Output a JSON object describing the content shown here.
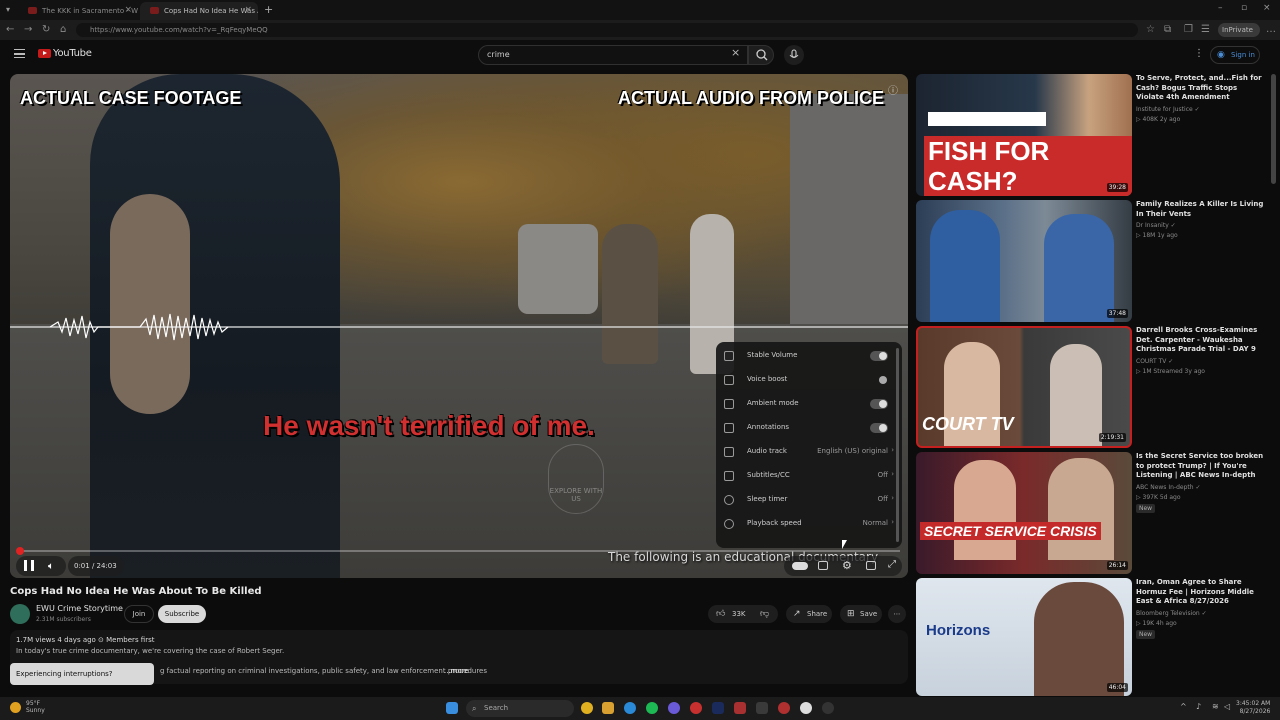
{
  "browser": {
    "tabs": [
      {
        "label": "The KKK in Sacramento - What W..."
      },
      {
        "label": "Cops Had No Idea He Was Ab..."
      }
    ],
    "url": "https://www.youtube.com/watch?v=_RqFeqyMeQQ",
    "profile_label": "InPrivate"
  },
  "masthead": {
    "logo_text": "YouTube",
    "search_value": "crime",
    "signin_label": "Sign in"
  },
  "video": {
    "overlay_left": "ACTUAL CASE FOOTAGE",
    "overlay_right": "ACTUAL AUDIO FROM POLICE",
    "caption": "He wasn't terrified of me.",
    "subtitle": "The following is an educational documentary",
    "watermark": "EXPLORE WITH US",
    "time": "0:01 / 24:03",
    "progress_fraction": 0.0007,
    "accent_color": "#e02222"
  },
  "settings_menu": {
    "items": [
      {
        "label": "Stable Volume",
        "value": "",
        "kind": "toggle",
        "icon": "stable-volume-icon"
      },
      {
        "label": "Voice boost",
        "value": "",
        "kind": "toggle-small",
        "icon": "voice-boost-icon"
      },
      {
        "label": "Ambient mode",
        "value": "",
        "kind": "toggle",
        "icon": "ambient-mode-icon"
      },
      {
        "label": "Annotations",
        "value": "",
        "kind": "toggle",
        "icon": "annotations-icon"
      },
      {
        "label": "Audio track",
        "value": "English (US) original",
        "kind": "value",
        "icon": "audio-track-icon"
      },
      {
        "label": "Subtitles/CC",
        "value": "Off",
        "kind": "value",
        "icon": "subtitles-icon"
      },
      {
        "label": "Sleep timer",
        "value": "Off",
        "kind": "value",
        "icon": "sleep-timer-icon"
      },
      {
        "label": "Playback speed",
        "value": "Normal",
        "kind": "value",
        "icon": "playback-speed-icon"
      }
    ]
  },
  "info": {
    "title": "Cops Had No Idea He Was About To Be Killed",
    "channel": "EWU Crime Storytime",
    "subscribers": "2.31M subscribers",
    "join_label": "Join",
    "subscribe_label": "Subscribe",
    "likes": "33K",
    "share_label": "Share",
    "save_label": "Save",
    "views_line": "1.7M views  4 days ago  ⊙ Members first",
    "desc_line1": "In today's true crime documentary, we're covering the case of Robert Seger.",
    "desc_line2": "g factual reporting on criminal investigations, public safety, and law enforcement procedures",
    "more_label": "...more",
    "toast": "Experiencing interruptions?"
  },
  "recommendations": [
    {
      "title": "To Serve, Protect, and...Fish for Cash? Bogus Traffic Stops Violate 4th Amendment",
      "channel": "Institute for Justice ✓",
      "meta": "▷ 408K  2y ago",
      "duration": "39:28",
      "badge": "",
      "thumb_text": "FISH FOR CASH?"
    },
    {
      "title": "Family Realizes A Killer Is Living In Their Vents",
      "channel": "Dr Insanity ✓",
      "meta": "▷ 18M  1y ago",
      "duration": "37:48",
      "badge": "",
      "thumb_text": ""
    },
    {
      "title": "Darrell Brooks Cross-Examines Det. Carpenter - Waukesha Christmas Parade Trial - DAY 9",
      "channel": "COURT TV ✓",
      "meta": "▷ 1M  Streamed 3y ago",
      "duration": "2:19:31",
      "badge": "",
      "thumb_text": "COURT TV"
    },
    {
      "title": "Is the Secret Service too broken to protect Trump? | If You're Listening | ABC News In-depth",
      "channel": "ABC News In-depth ✓",
      "meta": "▷ 397K  5d ago",
      "duration": "26:14",
      "badge": "New",
      "thumb_text": "SECRET SERVICE CRISIS"
    },
    {
      "title": "Iran, Oman Agree to Share Hormuz Fee | Horizons Middle East & Africa 8/27/2026",
      "channel": "Bloomberg Television ✓",
      "meta": "▷ 19K  4h ago",
      "duration": "46:04",
      "badge": "New",
      "thumb_text": "Horizons"
    }
  ],
  "taskbar": {
    "search_label": "Search",
    "temp": "95°F",
    "weather": "Sunny",
    "time": "3:45:02 AM",
    "date": "8/27/2026"
  }
}
